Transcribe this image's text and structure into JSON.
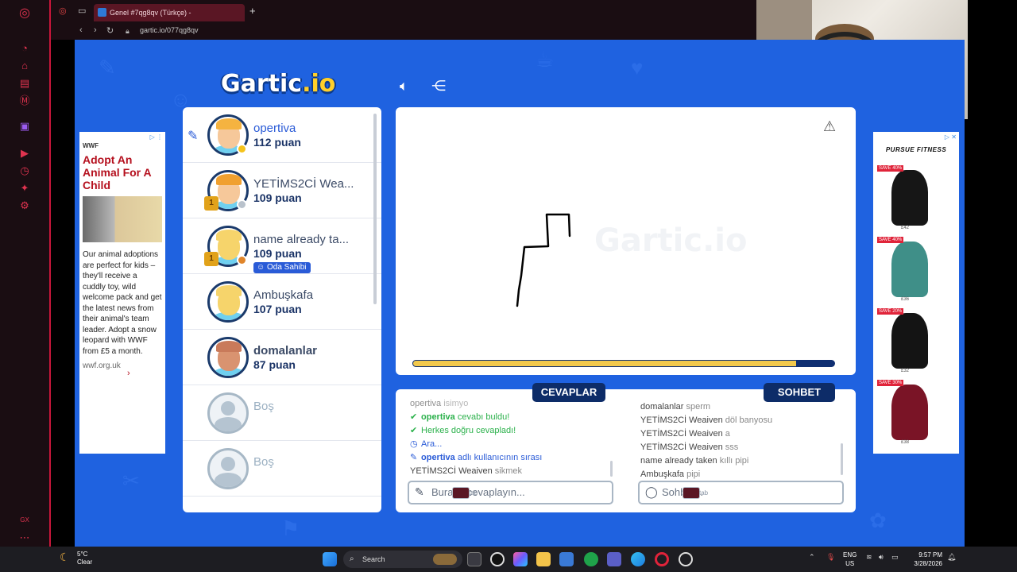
{
  "browser": {
    "tab_title": "Genel #7qg8qv (Türkçe) -",
    "url": "gartic.io/077qg8qv"
  },
  "logo": {
    "text": "Gartic",
    "suffix": ".io"
  },
  "ad_left": {
    "brand": "WWF",
    "headline": "Adopt An Animal For A Child",
    "copy": "Our animal adoptions are perfect for kids – they'll receive a cuddly toy, wild welcome pack and get the latest news from their animal's team leader. Adopt a snow leopard with WWF from £5 a month.",
    "domain": "wwf.org.uk"
  },
  "ad_right": {
    "brand": "PURSUE FITNESS",
    "products": [
      {
        "badge": "SAVE 40%",
        "price": "£42",
        "color": "#161616"
      },
      {
        "badge": "SAVE 40%",
        "price": "£36",
        "color": "#3f8f88"
      },
      {
        "badge": "SAVE 20%",
        "price": "£32",
        "color": "#141414"
      },
      {
        "badge": "SAVE 30%",
        "price": "£38",
        "color": "#7a1426"
      }
    ]
  },
  "players": [
    {
      "name": "opertiva",
      "points": "112 puan",
      "drawing": true,
      "status_color": "#f5c31b",
      "face": "#f6c89a",
      "hair": "#f5b340"
    },
    {
      "name": "YETİMS2Cİ Wea...",
      "points": "109 puan",
      "rank": "1",
      "status_color": "#b9c2cc",
      "face": "#f6c89a",
      "hair": "#f0a030"
    },
    {
      "name": "name already ta...",
      "points": "109 puan",
      "rank": "1",
      "status_color": "#e0852a",
      "owner_label": "Oda Sahibi",
      "face": "#f6d46b",
      "hair": "#f6d46b"
    },
    {
      "name": "Ambuşkafa",
      "points": "107 puan",
      "face": "#f6d46b",
      "hair": "#f6d46b"
    },
    {
      "name": "domalanlar",
      "points": "87 puan",
      "face": "#d99370",
      "hair": "#c97a5a"
    },
    {
      "name": "Boş",
      "empty": true
    },
    {
      "name": "Boş",
      "empty": true
    }
  ],
  "canvas": {
    "watermark": "Gartic.io",
    "timer_progress": 0.91
  },
  "panel": {
    "answers_label": "CEVAPLAR",
    "chat_label": "SOHBET",
    "answers_log": [
      {
        "user": "opertiva",
        "text": "isimyo",
        "type": "plain"
      },
      {
        "user": "opertiva",
        "text": "cevabı buldu!",
        "type": "found"
      },
      {
        "user": "",
        "text": "Herkes doğru cevapladı!",
        "type": "all"
      },
      {
        "user": "",
        "text": "Ara...",
        "type": "wait"
      },
      {
        "user": "opertiva",
        "text": "adlı kullanıcının sırası",
        "type": "turn"
      },
      {
        "user": "YETİMS2Cİ Weaiven",
        "text": "sikmek",
        "type": "plain"
      }
    ],
    "chat_log": [
      {
        "user": "domalanlar",
        "text": "sperm"
      },
      {
        "user": "YETİMS2Cİ Weaiven",
        "text": "döl banyosu"
      },
      {
        "user": "YETİMS2Cİ Weaiven",
        "text": "a"
      },
      {
        "user": "YETİMS2Cİ Weaiven",
        "text": "sss"
      },
      {
        "user": "name already taken",
        "text": "kıllı pipi"
      },
      {
        "user": "Ambuşkafa",
        "text": "pipi"
      }
    ],
    "answer_placeholder": "Buraya cevaplayın...",
    "chat_placeholder": "Sohbet...",
    "tab_hint": "tab"
  },
  "taskbar": {
    "temp": "5°C",
    "weather": "Clear",
    "search": "Search",
    "lang_top": "ENG",
    "lang_bottom": "US",
    "time": "9:57 PM",
    "date": "3/28/2026"
  }
}
